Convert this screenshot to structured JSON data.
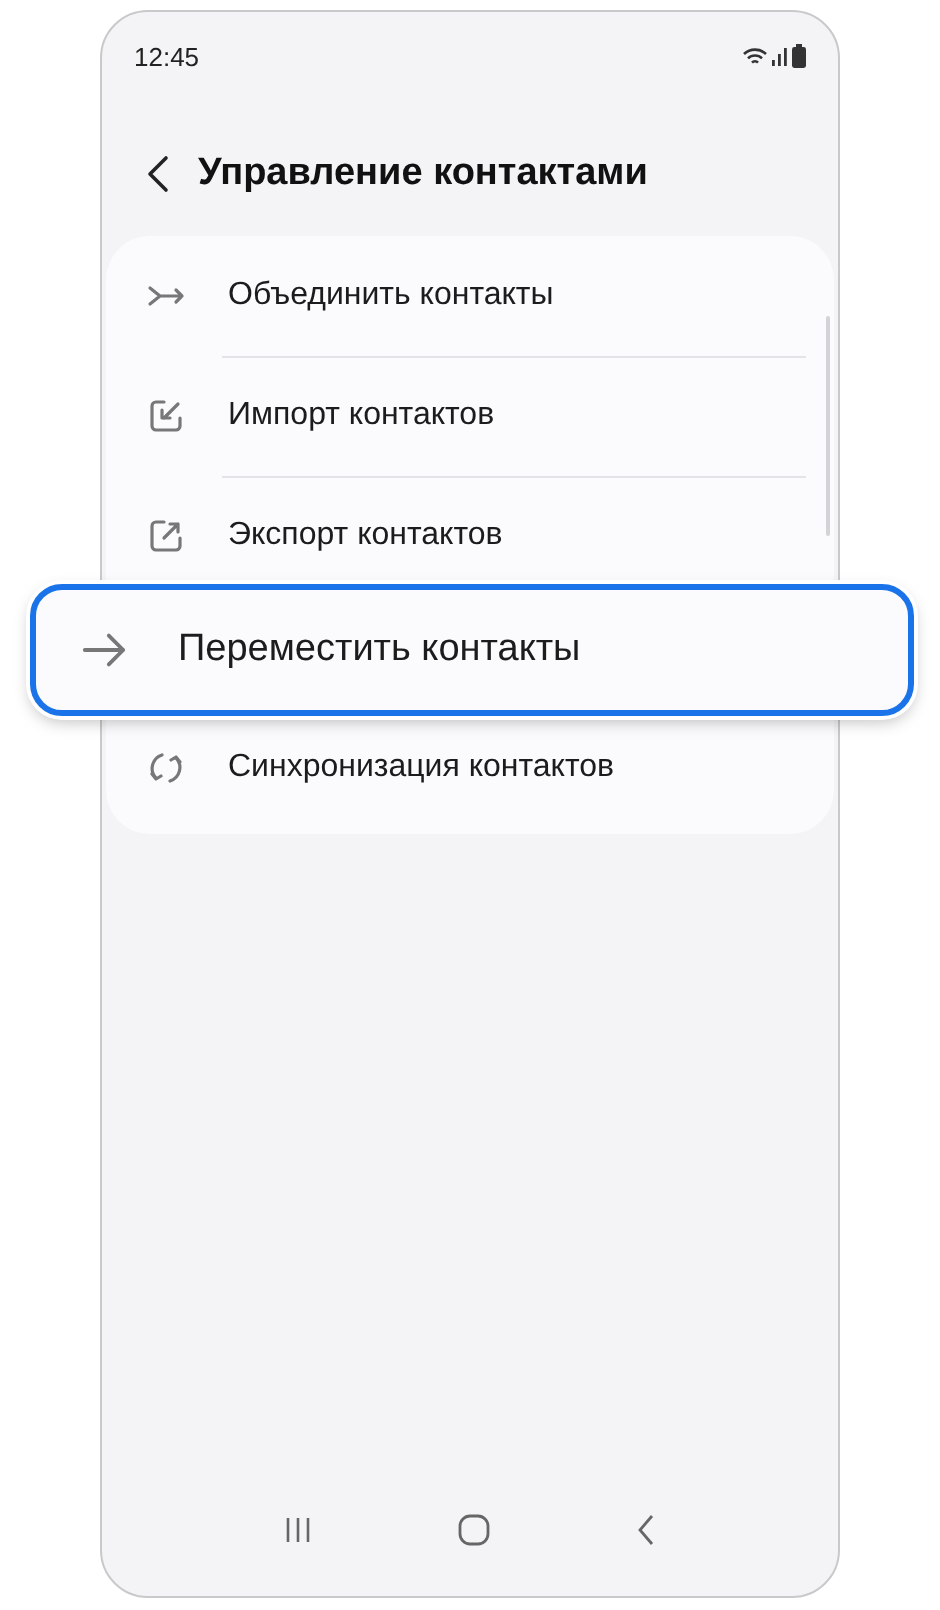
{
  "status_bar": {
    "time": "12:45"
  },
  "header": {
    "title": "Управление контактами"
  },
  "menu": {
    "items": [
      {
        "kind": "merge",
        "label": "Объединить контакты",
        "highlighted": false
      },
      {
        "kind": "import",
        "label": "Импорт контактов",
        "highlighted": false
      },
      {
        "kind": "export",
        "label": "Экспорт контактов",
        "highlighted": false
      },
      {
        "kind": "move",
        "label": "Переместить контакты",
        "highlighted": true
      },
      {
        "kind": "sync",
        "label": "Синхронизация контактов",
        "highlighted": false
      }
    ]
  }
}
